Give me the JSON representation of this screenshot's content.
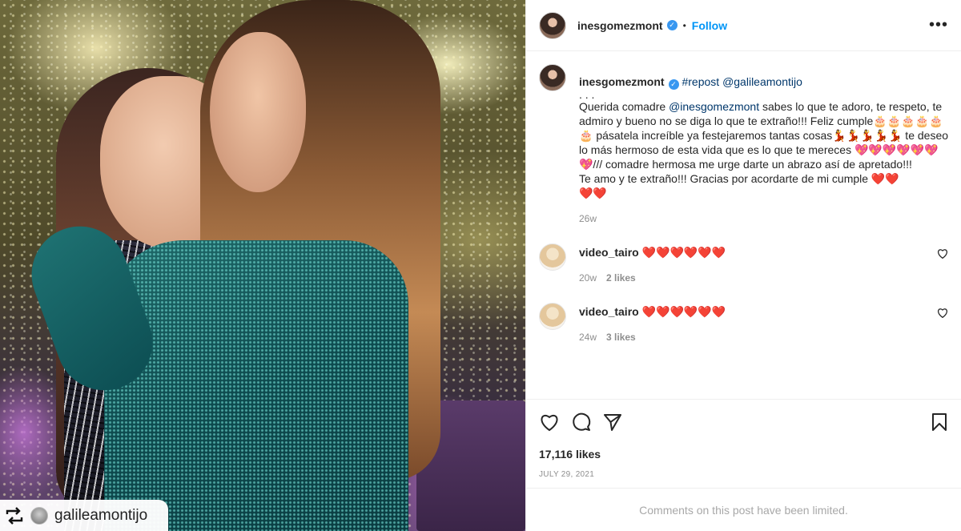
{
  "post": {
    "photo_overlay": {
      "repost_icon": "repost-arrows-icon",
      "handle": "galileamontijo"
    }
  },
  "header": {
    "username": "inesgomezmont",
    "verified_icon": "verified-badge-icon",
    "separator": "•",
    "follow_label": "Follow",
    "more_icon": "more-options-icon",
    "more_glyph": "•••"
  },
  "caption": {
    "username": "inesgomezmont",
    "hashtag": "#repost",
    "mention": "@galileamontijo",
    "dots": ". . .",
    "text_part1": "Querida comadre ",
    "text_mention": "@inesgomezmont",
    "text_part2": " sabes lo que te adoro, te respeto, te admiro y bueno no se diga lo que te extraño!!! Feliz cumple🎂🎂🎂🎂🎂🎂 pásatela increíble ya festejaremos tantas cosas💃💃💃💃💃 te deseo lo más hermoso de esta vida que es lo que te mereces 💖💖💖💖💖💖💖/// comadre hermosa me urge darte un abrazo así de apretado!!!\nTe amo y te extraño!!! Gracias por acordarte de mi cumple ❤️❤️\n❤️❤️",
    "time": "26w"
  },
  "comments": [
    {
      "username": "video_tairo",
      "text": "❤️❤️❤️❤️❤️❤️",
      "time": "20w",
      "likes": "2 likes",
      "like_icon": "heart-outline-icon"
    },
    {
      "username": "video_tairo",
      "text": "❤️❤️❤️❤️❤️❤️",
      "time": "24w",
      "likes": "3 likes",
      "like_icon": "heart-outline-icon"
    }
  ],
  "actions": {
    "like_icon": "heart-outline-icon",
    "comment_icon": "comment-bubble-icon",
    "share_icon": "paper-plane-icon",
    "save_icon": "bookmark-icon",
    "likes_count": "17,116 likes",
    "date": "JULY 29, 2021"
  },
  "footer": {
    "limited_text": "Comments on this post have been limited."
  },
  "colors": {
    "link": "#00376b",
    "follow": "#0095f6",
    "muted": "#8e8e8e",
    "verified": "#3897f0"
  }
}
